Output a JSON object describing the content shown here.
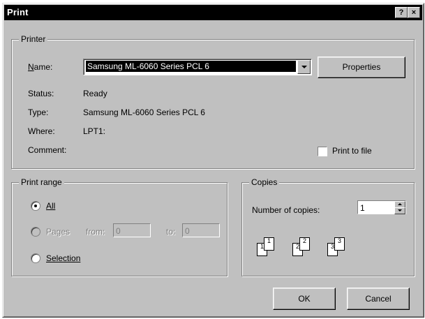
{
  "window": {
    "title": "Print",
    "help_glyph": "?",
    "close_glyph": "×"
  },
  "printer": {
    "group_label": "Printer",
    "name_label": "Name:",
    "name_value": "Samsung ML-6060 Series PCL 6",
    "properties_label": "Properties",
    "status_label": "Status:",
    "status_value": "Ready",
    "type_label": "Type:",
    "type_value": "Samsung ML-6060 Series PCL 6",
    "where_label": "Where:",
    "where_value": "LPT1:",
    "comment_label": "Comment:",
    "print_to_file_label": "Print to file",
    "print_to_file_checked": false
  },
  "print_range": {
    "group_label": "Print range",
    "all_label": "All",
    "pages_label": "Pages",
    "from_label": "from:",
    "from_value": "0",
    "to_label": "to:",
    "to_value": "0",
    "selection_label": "Selection",
    "selected": "All"
  },
  "copies": {
    "group_label": "Copies",
    "number_label": "Number of copies:",
    "number_value": "1",
    "collate_pages": [
      "1",
      "1",
      "2",
      "2",
      "3",
      "3"
    ]
  },
  "buttons": {
    "ok": "OK",
    "cancel": "Cancel"
  }
}
